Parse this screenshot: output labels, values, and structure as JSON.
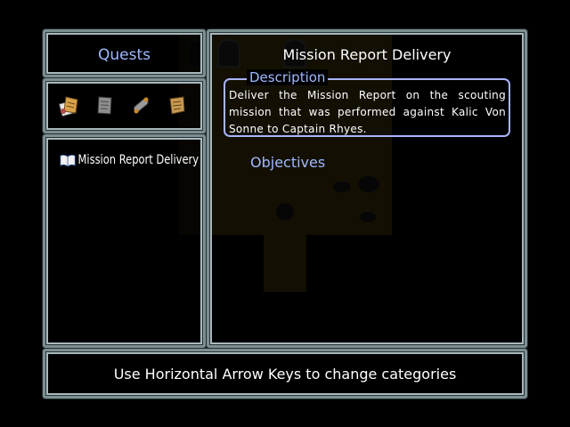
{
  "quests_panel": {
    "title": "Quests"
  },
  "categories": [
    {
      "icon": "scroll-bundle-icon"
    },
    {
      "icon": "parchment-icon"
    },
    {
      "icon": "rolled-scroll-icon"
    },
    {
      "icon": "old-scroll-icon"
    }
  ],
  "quest_list": {
    "items": [
      {
        "icon": "open-book-icon",
        "label": "Mission Report Delivery"
      }
    ]
  },
  "detail": {
    "title": "Mission Report Delivery",
    "description_label": "Description",
    "description": "Deliver the Mission Report on the scouting mission that was performed against Kalic Von Sonne to Captain Rhyes.",
    "objectives_label": "Objectives"
  },
  "help": {
    "text": "Use Horizontal Arrow Keys to change categories"
  },
  "colors": {
    "accent_text": "#9fb8ff",
    "frame": "#7c8f93",
    "box_border": "#a9b4ff"
  }
}
